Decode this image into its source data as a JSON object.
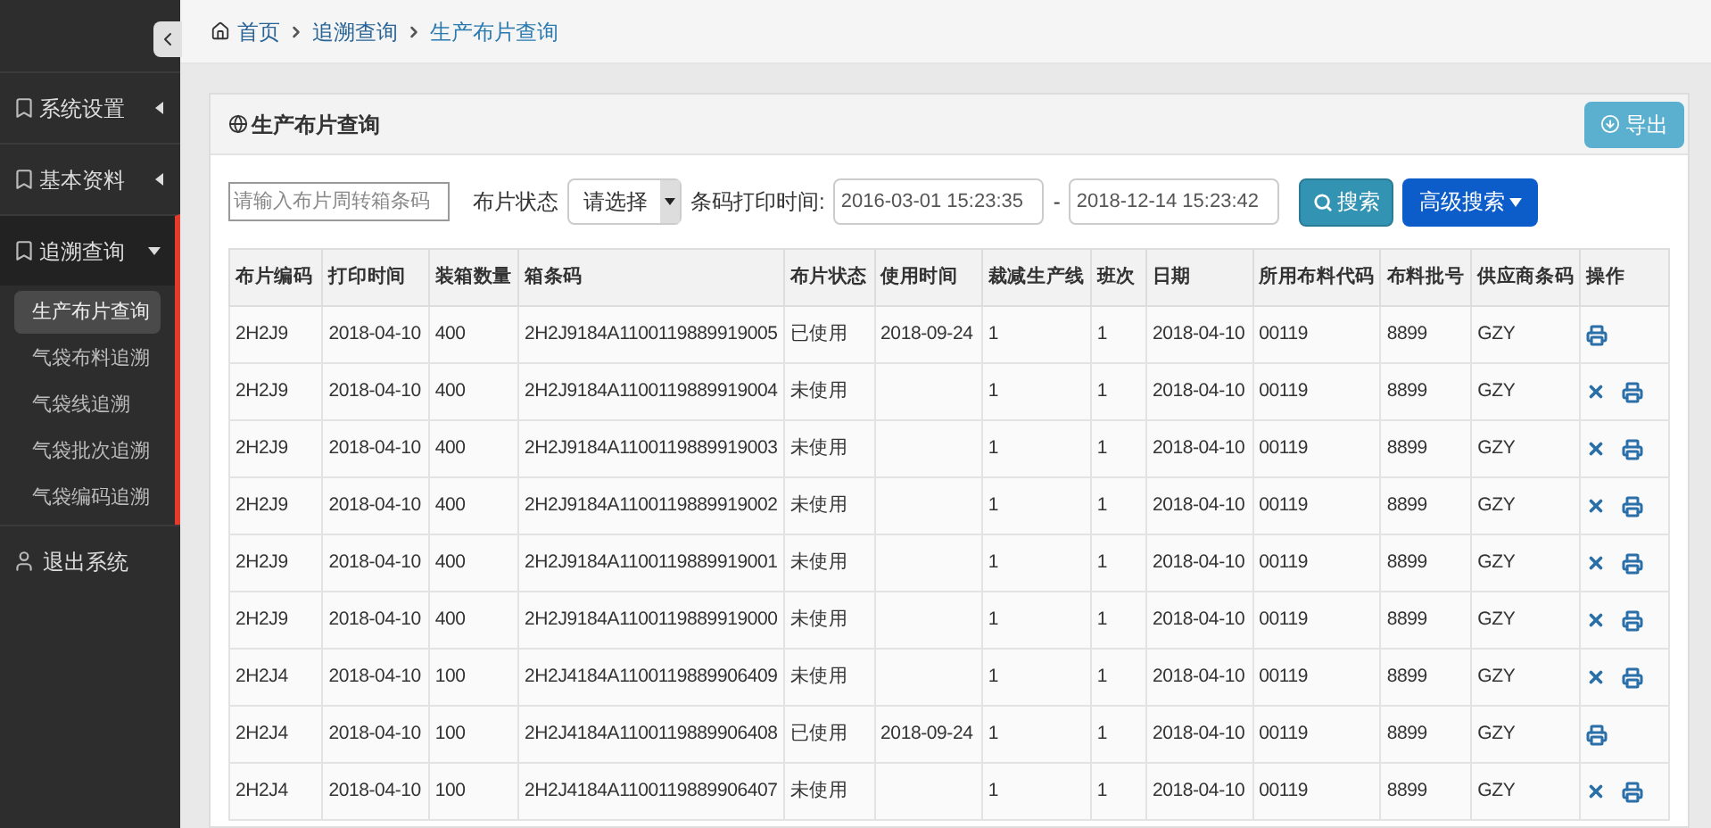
{
  "breadcrumb": [
    "首页",
    "追溯查询",
    "生产布片查询"
  ],
  "sidebar": {
    "items": [
      {
        "label": "系统设置",
        "expanded": false
      },
      {
        "label": "基本资料",
        "expanded": false
      },
      {
        "label": "追溯查询",
        "expanded": true,
        "children": [
          {
            "label": "生产布片查询",
            "selected": true
          },
          {
            "label": "气袋布料追溯",
            "selected": false
          },
          {
            "label": "气袋线追溯",
            "selected": false
          },
          {
            "label": "气袋批次追溯",
            "selected": false
          },
          {
            "label": "气袋编码追溯",
            "selected": false
          }
        ]
      }
    ],
    "logout": "退出系统"
  },
  "panel": {
    "title": "生产布片查询",
    "export_button": "导出"
  },
  "filters": {
    "barcode_field": {
      "placeholder": "请输入布片周转箱条码"
    },
    "status_label": "布片状态",
    "status_select": "请选择",
    "time_label": "条码打印时间:",
    "time_from": "2016-03-01 15:23:35",
    "separator": "-",
    "time_to": "2018-12-14 15:23:42",
    "search_button": "搜索",
    "advanced_button": "高级搜索"
  },
  "table": {
    "columns": [
      "布片编码",
      "打印时间",
      "装箱数量",
      "箱条码",
      "布片状态",
      "使用时间",
      "裁减生产线",
      "班次",
      "日期",
      "所用布料代码",
      "布料批号",
      "供应商条码",
      "操作"
    ],
    "rows": [
      {
        "cells": [
          "2H2J9",
          "2018-04-10",
          "400",
          "2H2J9184A1100119889919005",
          "已使用",
          "2018-09-24",
          "1",
          "1",
          "2018-04-10",
          "00119",
          "8899",
          "GZY"
        ],
        "deletable": false
      },
      {
        "cells": [
          "2H2J9",
          "2018-04-10",
          "400",
          "2H2J9184A1100119889919004",
          "未使用",
          "",
          "1",
          "1",
          "2018-04-10",
          "00119",
          "8899",
          "GZY"
        ],
        "deletable": true
      },
      {
        "cells": [
          "2H2J9",
          "2018-04-10",
          "400",
          "2H2J9184A1100119889919003",
          "未使用",
          "",
          "1",
          "1",
          "2018-04-10",
          "00119",
          "8899",
          "GZY"
        ],
        "deletable": true
      },
      {
        "cells": [
          "2H2J9",
          "2018-04-10",
          "400",
          "2H2J9184A1100119889919002",
          "未使用",
          "",
          "1",
          "1",
          "2018-04-10",
          "00119",
          "8899",
          "GZY"
        ],
        "deletable": true
      },
      {
        "cells": [
          "2H2J9",
          "2018-04-10",
          "400",
          "2H2J9184A1100119889919001",
          "未使用",
          "",
          "1",
          "1",
          "2018-04-10",
          "00119",
          "8899",
          "GZY"
        ],
        "deletable": true
      },
      {
        "cells": [
          "2H2J9",
          "2018-04-10",
          "400",
          "2H2J9184A1100119889919000",
          "未使用",
          "",
          "1",
          "1",
          "2018-04-10",
          "00119",
          "8899",
          "GZY"
        ],
        "deletable": true
      },
      {
        "cells": [
          "2H2J4",
          "2018-04-10",
          "100",
          "2H2J4184A1100119889906409",
          "未使用",
          "",
          "1",
          "1",
          "2018-04-10",
          "00119",
          "8899",
          "GZY"
        ],
        "deletable": true
      },
      {
        "cells": [
          "2H2J4",
          "2018-04-10",
          "100",
          "2H2J4184A1100119889906408",
          "已使用",
          "2018-09-24",
          "1",
          "1",
          "2018-04-10",
          "00119",
          "8899",
          "GZY"
        ],
        "deletable": false
      },
      {
        "cells": [
          "2H2J4",
          "2018-04-10",
          "100",
          "2H2J4184A1100119889906407",
          "未使用",
          "",
          "1",
          "1",
          "2018-04-10",
          "00119",
          "8899",
          "GZY"
        ],
        "deletable": true
      }
    ]
  }
}
